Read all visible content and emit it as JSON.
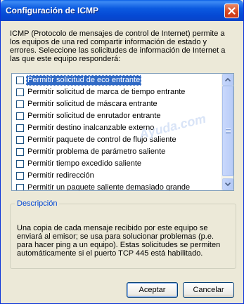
{
  "window": {
    "title": "Configuración de ICMP",
    "close_icon": "close-icon"
  },
  "intro_text": "ICMP (Protocolo de mensajes de control de Internet) permite a los equipos de una red compartir información de estado y errores. Seleccione las solicitudes de información de Internet a las que este equipo responderá:",
  "options": [
    {
      "label": "Permitir solicitud de eco entrante",
      "checked": false,
      "selected": true
    },
    {
      "label": "Permitir solicitud de marca de tiempo entrante",
      "checked": false,
      "selected": false
    },
    {
      "label": "Permitir solicitud de máscara entrante",
      "checked": false,
      "selected": false
    },
    {
      "label": "Permitir solicitud de enrutador entrante",
      "checked": false,
      "selected": false
    },
    {
      "label": "Permitir destino inalcanzable externo",
      "checked": false,
      "selected": false
    },
    {
      "label": "Permitir paquete de control de flujo saliente",
      "checked": false,
      "selected": false
    },
    {
      "label": "Permitir problema de parámetro saliente",
      "checked": false,
      "selected": false
    },
    {
      "label": "Permitir tiempo excedido saliente",
      "checked": false,
      "selected": false
    },
    {
      "label": "Permitir redirección",
      "checked": false,
      "selected": false
    },
    {
      "label": "Permitir un paquete saliente demasiado grande",
      "checked": false,
      "selected": false
    }
  ],
  "description": {
    "title": "Descripción",
    "text": "Una copia de cada mensaje recibido por este equipo se enviará al emisor; se usa para solucionar problemas (p.e. para hacer ping a un equipo). Estas solicitudes se permiten automáticamente si el puerto TCP 445 está habilitado."
  },
  "buttons": {
    "ok": "Aceptar",
    "cancel": "Cancelar"
  },
  "watermark": "Ayuda.com",
  "colors": {
    "titlebar": "#0a5fe6",
    "selection": "#316ac5",
    "group_title": "#0046d5",
    "close_button": "#d6451d",
    "dialog_bg": "#ece9d8"
  }
}
